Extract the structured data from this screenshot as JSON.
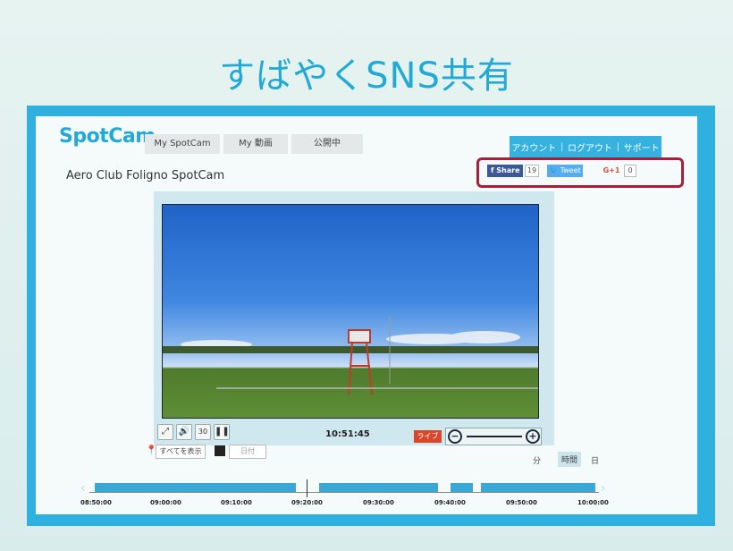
{
  "slide": {
    "title": "すばやくSNS共有"
  },
  "header": {
    "logo": "SpotCam",
    "nav": [
      "My SpotCam",
      "My 動画",
      "公開中"
    ],
    "account_links": [
      "アカウント",
      "ログアウト",
      "サポート"
    ]
  },
  "camera": {
    "title": "Aero Club Foligno SpotCam"
  },
  "share": {
    "facebook_label": "Share",
    "facebook_count": "19",
    "twitter_label": "Tweet",
    "gplus_label": "G+1",
    "gplus_count": "0"
  },
  "player": {
    "time": "10:51:45",
    "live_label": "ライブ",
    "replay_icon_label": "30",
    "show_all_label": "すべてを表示",
    "date_placeholder": "日付"
  },
  "ranges": {
    "minute": "分",
    "hour": "時間",
    "day": "日"
  },
  "timeline": {
    "labels": [
      "08:50:00",
      "09:00:00",
      "09:10:00",
      "09:20:00",
      "09:30:00",
      "09:40:00",
      "09:50:00",
      "10:00:00"
    ]
  },
  "colors": {
    "accent": "#23a9d8",
    "highlight_box": "#a7203b",
    "live": "#d9472b",
    "facebook": "#3b5998",
    "twitter": "#55acee"
  }
}
